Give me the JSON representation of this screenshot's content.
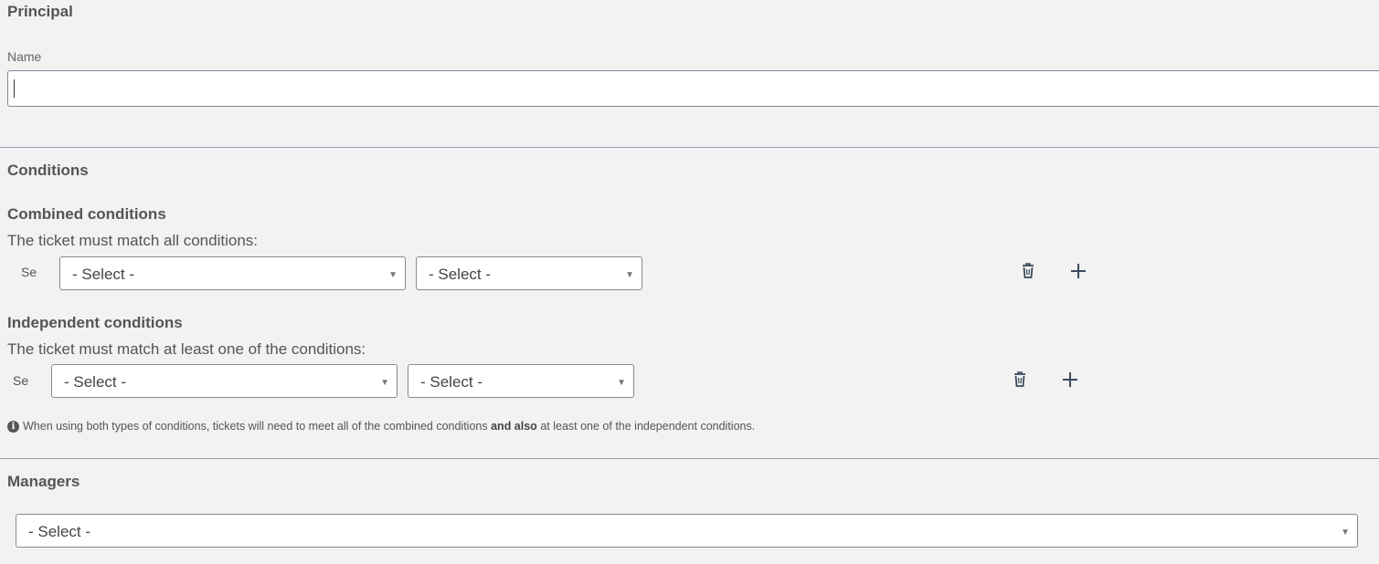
{
  "principal": {
    "title": "Principal",
    "name_label": "Name",
    "name_value": "",
    "name_placeholder": ""
  },
  "conditions": {
    "title": "Conditions",
    "combined": {
      "title": "Combined conditions",
      "description": "The ticket must match all conditions:",
      "row_prefix": "Se",
      "select1": "- Select -",
      "select2": "- Select -"
    },
    "independent": {
      "title": "Independent conditions",
      "description": "The ticket must match at least one of the conditions:",
      "row_prefix": "Se",
      "select1": "- Select -",
      "select2": "- Select -"
    },
    "note": {
      "before": "When using both types of conditions, tickets will need to meet all of the combined conditions",
      "bold": "and also",
      "after": "at least one of the independent conditions."
    }
  },
  "managers": {
    "title": "Managers",
    "select": "- Select -"
  },
  "icons": {
    "delete": "trash-icon",
    "add": "plus-icon",
    "info": "info-icon"
  },
  "colors": {
    "background": "#f2f2f2",
    "divider": "#8fa0b0",
    "icon": "#3a4a5e"
  }
}
